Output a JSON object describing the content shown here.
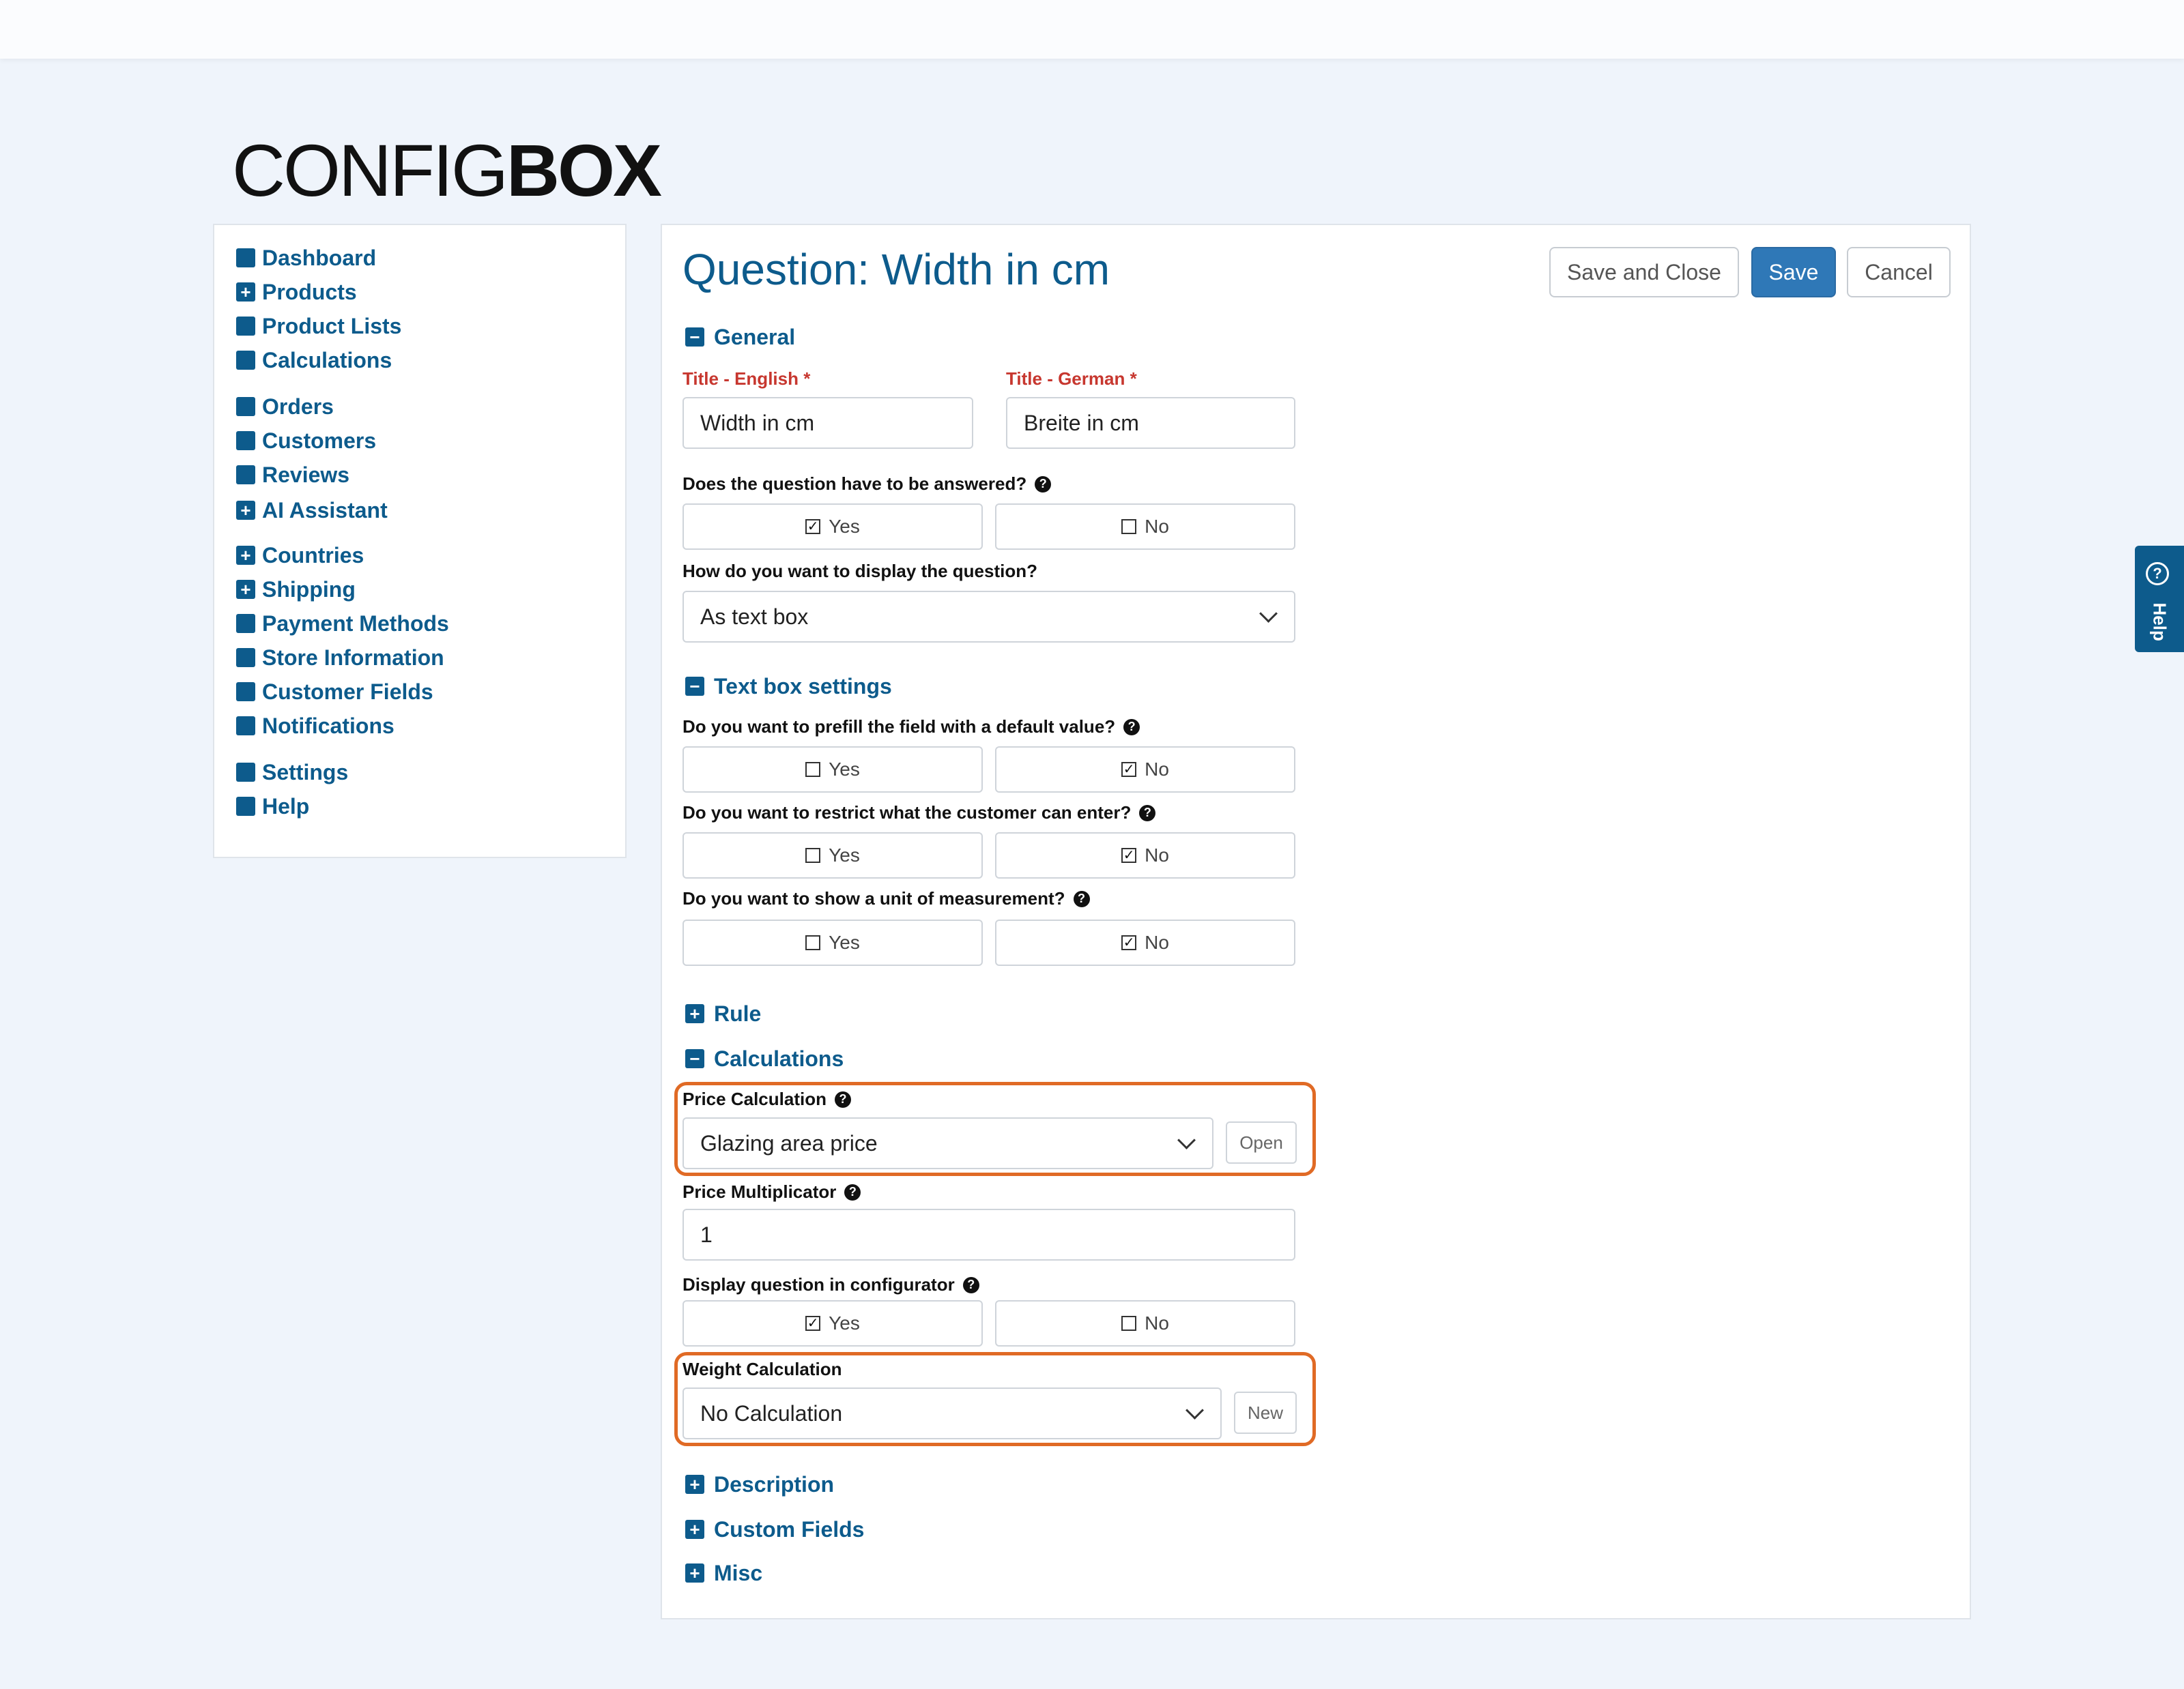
{
  "brand": {
    "logo_light": "CONFIG",
    "logo_bold": "BOX"
  },
  "sidebar": {
    "items": [
      {
        "label": "Dashboard",
        "icon": "square-icon"
      },
      {
        "label": "Products",
        "icon": "plus-square-icon"
      },
      {
        "label": "Product Lists",
        "icon": "square-icon"
      },
      {
        "label": "Calculations",
        "icon": "square-icon"
      },
      {
        "label": "Orders",
        "icon": "square-icon"
      },
      {
        "label": "Customers",
        "icon": "square-icon"
      },
      {
        "label": "Reviews",
        "icon": "square-icon"
      },
      {
        "label": "AI Assistant",
        "icon": "plus-square-icon"
      },
      {
        "label": "Countries",
        "icon": "plus-square-icon"
      },
      {
        "label": "Shipping",
        "icon": "plus-square-icon"
      },
      {
        "label": "Payment Methods",
        "icon": "square-icon"
      },
      {
        "label": "Store Information",
        "icon": "square-icon"
      },
      {
        "label": "Customer Fields",
        "icon": "square-icon"
      },
      {
        "label": "Notifications",
        "icon": "square-icon"
      },
      {
        "label": "Settings",
        "icon": "square-icon"
      },
      {
        "label": "Help",
        "icon": "square-icon"
      }
    ]
  },
  "main": {
    "title": "Question: Width in cm",
    "buttons": {
      "save_close": "Save and Close",
      "save": "Save",
      "cancel": "Cancel"
    },
    "general": {
      "heading": "General",
      "title_en_label": "Title - English *",
      "title_en_value": "Width in cm",
      "title_de_label": "Title - German *",
      "title_de_value": "Breite in cm",
      "required_q": "Does the question have to be answered?",
      "required_selected": "Yes",
      "display_q": "How do you want to display the question?",
      "display_value": "As text box"
    },
    "textbox": {
      "heading": "Text box settings",
      "prefill_q": "Do you want to prefill the field with a default value?",
      "prefill_selected": "No",
      "restrict_q": "Do you want to restrict what the customer can enter?",
      "restrict_selected": "No",
      "unit_q": "Do you want to show a unit of measurement?",
      "unit_selected": "No"
    },
    "rule": {
      "heading": "Rule"
    },
    "calculations": {
      "heading": "Calculations",
      "price_calc_label": "Price Calculation",
      "price_calc_value": "Glazing area price",
      "open_label": "Open",
      "price_mult_label": "Price Multiplicator",
      "price_mult_value": "1",
      "display_in_conf_label": "Display question in configurator",
      "display_in_conf_selected": "Yes",
      "weight_calc_label": "Weight Calculation",
      "weight_calc_value": "No Calculation",
      "new_label": "New"
    },
    "description": {
      "heading": "Description"
    },
    "custom_fields": {
      "heading": "Custom Fields"
    },
    "misc": {
      "heading": "Misc"
    },
    "yes_label": "Yes",
    "no_label": "No"
  },
  "help_tab": {
    "label": "Help"
  },
  "colors": {
    "brand_blue": "#0d5b8c",
    "primary_button": "#2f78b7",
    "required_red": "#c7372f",
    "highlight_orange": "#e06a25"
  }
}
